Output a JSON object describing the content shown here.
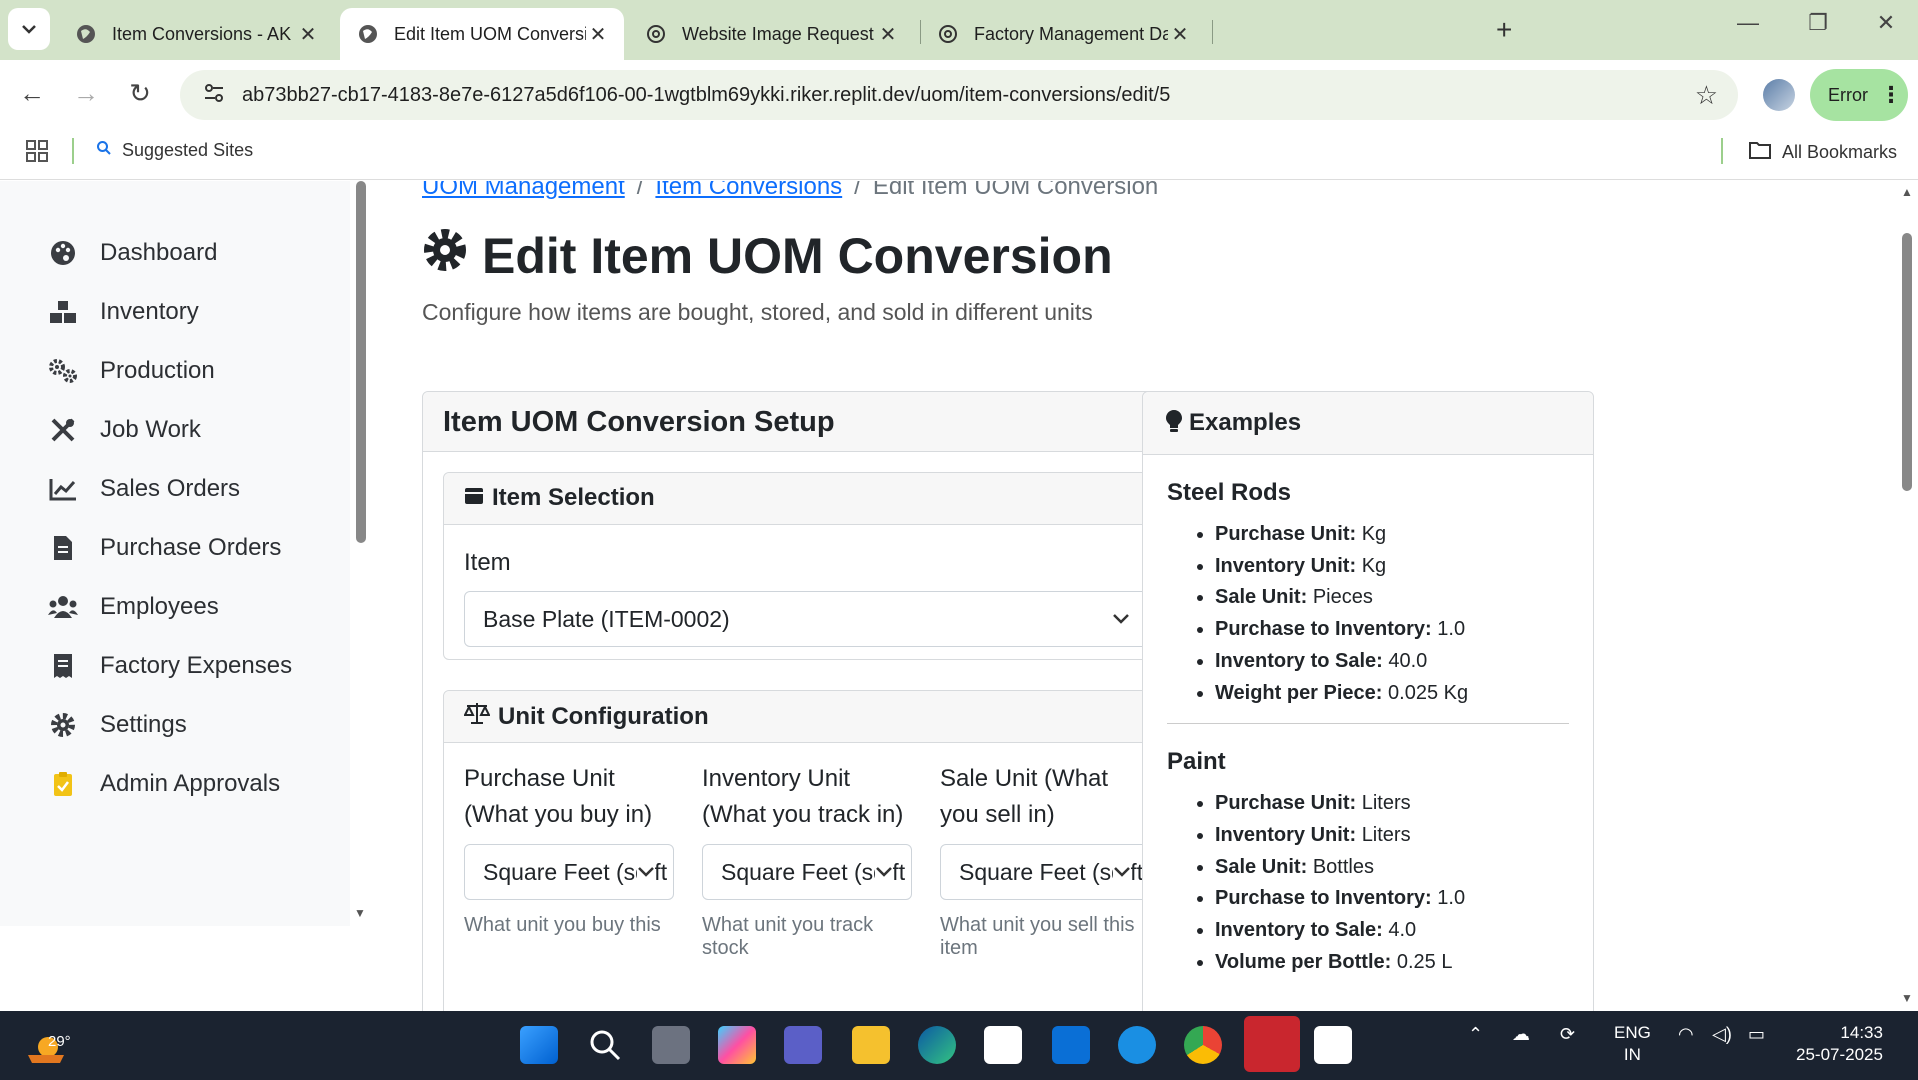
{
  "browser": {
    "tabs": [
      {
        "title": "Item Conversions - AK Innovatio",
        "active": false
      },
      {
        "title": "Edit Item UOM Conversion - AK",
        "active": true
      },
      {
        "title": "Website Image Request",
        "active": false
      },
      {
        "title": "Factory Management Data",
        "active": false
      }
    ],
    "url": "ab73bb27-cb17-4183-8e7e-6127a5d6f106-00-1wgtblm69ykki.riker.replit.dev/uom/item-conversions/edit/5",
    "error_label": "Error",
    "bookmarks": {
      "suggested": "Suggested Sites",
      "all": "All Bookmarks"
    }
  },
  "sidebar": {
    "items": [
      {
        "label": "Dashboard",
        "icon": "palette-icon"
      },
      {
        "label": "Inventory",
        "icon": "boxes-icon"
      },
      {
        "label": "Production",
        "icon": "gears-icon"
      },
      {
        "label": "Job Work",
        "icon": "tools-icon"
      },
      {
        "label": "Sales Orders",
        "icon": "chart-line-icon"
      },
      {
        "label": "Purchase Orders",
        "icon": "file-invoice-icon"
      },
      {
        "label": "Employees",
        "icon": "users-icon"
      },
      {
        "label": "Factory Expenses",
        "icon": "receipt-icon"
      },
      {
        "label": "Settings",
        "icon": "gear-icon"
      },
      {
        "label": "Admin Approvals",
        "icon": "clipboard-check-icon"
      }
    ]
  },
  "breadcrumb": {
    "items": [
      "UOM Management",
      "Item Conversions",
      "Edit Item UOM Conversion"
    ],
    "sep": "/"
  },
  "page": {
    "title": "Edit Item UOM Conversion",
    "subtitle": "Configure how items are bought, stored, and sold in different units"
  },
  "setup": {
    "title": "Item UOM Conversion Setup",
    "item_selection": {
      "title": "Item Selection",
      "item_label": "Item",
      "item_value": "Base Plate (ITEM-0002)"
    },
    "unit_config": {
      "title": "Unit Configuration",
      "purchase": {
        "label": "Purchase Unit (What you buy in)",
        "value": "Square Feet (sq.ft",
        "help": "What unit you buy this"
      },
      "inventory": {
        "label": "Inventory Unit (What you track in)",
        "value": "Square Feet (sq.ft",
        "help": "What unit you track stock"
      },
      "sale": {
        "label": "Sale Unit (What you sell in)",
        "value": "Square Feet (sq.ft",
        "help": "What unit you sell this item"
      }
    }
  },
  "examples": {
    "title": "Examples",
    "groups": [
      {
        "name": "Steel Rods",
        "items": [
          {
            "k": "Purchase Unit:",
            "v": "Kg"
          },
          {
            "k": "Inventory Unit:",
            "v": "Kg"
          },
          {
            "k": "Sale Unit:",
            "v": "Pieces"
          },
          {
            "k": "Purchase to Inventory:",
            "v": "1.0"
          },
          {
            "k": "Inventory to Sale:",
            "v": "40.0"
          },
          {
            "k": "Weight per Piece:",
            "v": "0.025 Kg"
          }
        ]
      },
      {
        "name": "Paint",
        "items": [
          {
            "k": "Purchase Unit:",
            "v": "Liters"
          },
          {
            "k": "Inventory Unit:",
            "v": "Liters"
          },
          {
            "k": "Sale Unit:",
            "v": "Bottles"
          },
          {
            "k": "Purchase to Inventory:",
            "v": "1.0"
          },
          {
            "k": "Inventory to Sale:",
            "v": "4.0"
          },
          {
            "k": "Volume per Bottle:",
            "v": "0.25 L"
          }
        ]
      }
    ]
  },
  "taskbar": {
    "weather": "29°",
    "lang1": "ENG",
    "lang2": "IN",
    "time": "14:33",
    "date": "25-07-2025"
  }
}
